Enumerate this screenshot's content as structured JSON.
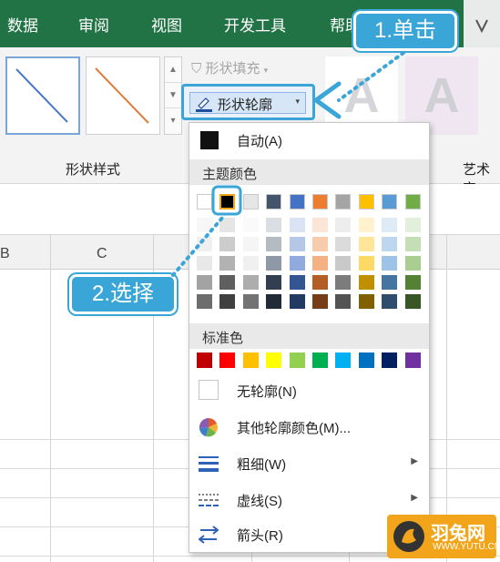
{
  "ribbon_tabs": [
    "数据",
    "审阅",
    "视图",
    "开发工具",
    "帮助"
  ],
  "ribbon": {
    "shape_fill_label": "形状填充",
    "shape_outline_label": "形状轮廓",
    "art_letters": [
      "A",
      "A"
    ],
    "group_shape_styles": "形状样式",
    "group_art": "艺术字",
    "swatch_colors": [
      "#4a78c8",
      "#e07b39"
    ]
  },
  "sheet": {
    "column_headers": [
      "B",
      "C"
    ]
  },
  "menu": {
    "auto_label": "自动(A)",
    "theme_colors_heading": "主题颜色",
    "theme_colors": [
      "#ffffff",
      "#000000",
      "#e7e6e6",
      "#44546a",
      "#4472c4",
      "#ed7d31",
      "#a5a5a5",
      "#ffc000",
      "#5b9bd5",
      "#70ad47"
    ],
    "selected_theme_color": "#000000",
    "standard_colors_heading": "标准色",
    "standard_colors": [
      "#c00000",
      "#ff0000",
      "#ffc000",
      "#ffff00",
      "#92d050",
      "#00b050",
      "#00b0f0",
      "#0070c0",
      "#002060",
      "#7030a0"
    ],
    "no_outline_label": "无轮廓(N)",
    "more_colors_label": "其他轮廓颜色(M)...",
    "weight_label": "粗细(W)",
    "dashes_label": "虚线(S)",
    "arrows_label": "箭头(R)"
  },
  "callouts": {
    "step1": "1.单击",
    "step2": "2.选择"
  },
  "watermark": {
    "title": "羽兔网",
    "url": "WWW.YUTU.CN"
  }
}
